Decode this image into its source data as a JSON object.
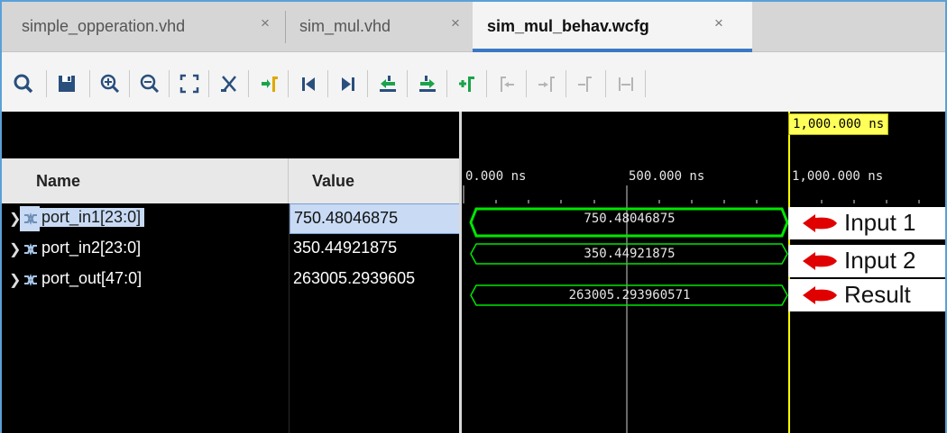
{
  "tabs": [
    {
      "label": "simple_opperation.vhd",
      "close": "×",
      "active": false
    },
    {
      "label": "sim_mul.vhd",
      "close": "×",
      "active": false
    },
    {
      "label": "sim_mul_behav.wcfg",
      "close": "×",
      "active": true
    }
  ],
  "toolbar": {
    "icons": [
      "search-icon",
      "save-icon",
      "zoom-in-icon",
      "zoom-out-icon",
      "zoom-fit-icon",
      "cursor-cut-icon",
      "go-to-cursor-icon",
      "go-to-start-icon",
      "go-to-end-icon",
      "previous-transition-icon",
      "next-transition-icon",
      "add-marker-icon",
      "previous-marker-icon",
      "next-marker-icon",
      "swap-cursors-icon",
      "snap-to-transition-icon"
    ]
  },
  "columns": {
    "name": "Name",
    "value": "Value"
  },
  "signals": [
    {
      "name": "port_in1[23:0]",
      "value": "750.48046875",
      "selected": true,
      "wave": "750.48046875",
      "annotation": "Input 1"
    },
    {
      "name": "port_in2[23:0]",
      "value": "350.44921875",
      "selected": false,
      "wave": "350.44921875",
      "annotation": "Input 2"
    },
    {
      "name": "port_out[47:0]",
      "value": "263005.2939605",
      "selected": false,
      "wave": "263005.293960571",
      "annotation": "Result"
    }
  ],
  "timeline": {
    "cursor_label": "1,000.000 ns",
    "ticks": [
      "0.000 ns",
      "500.000 ns",
      "1,000.000 ns"
    ]
  },
  "colors": {
    "wave": "#00e600",
    "cursor": "#ffff00",
    "arrow": "#e00000"
  }
}
